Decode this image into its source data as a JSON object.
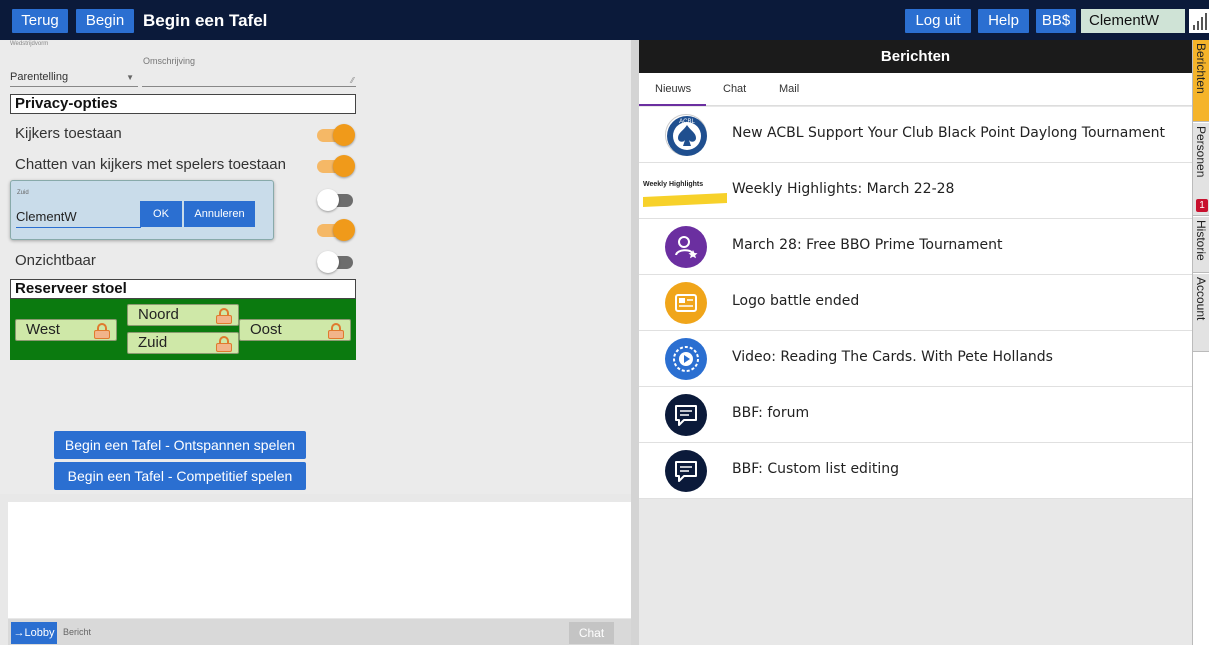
{
  "topbar": {
    "back": "Terug",
    "home": "Begin",
    "title": "Begin een Tafel",
    "logout": "Log uit",
    "help": "Help",
    "bb": "BB$",
    "user": "ClementW"
  },
  "form": {
    "wedstrijdvorm_label": "Wedstrijdvorm",
    "wedstrijdvorm_value": "Parentelling",
    "omschrijving_label": "Omschrijving"
  },
  "privacy": {
    "title": "Privacy-opties",
    "options": [
      {
        "label": "Kijkers toestaan",
        "on": true
      },
      {
        "label": "Chatten van kijkers met spelers toestaan",
        "on": true
      },
      {
        "label": "",
        "on": false
      },
      {
        "label": "",
        "on": true
      },
      {
        "label": "Onzichtbaar",
        "on": false
      }
    ]
  },
  "popup": {
    "seat_label": "Zuid",
    "input_value": "ClementW",
    "ok": "OK",
    "cancel": "Annuleren"
  },
  "seats": {
    "title": "Reserveer stoel",
    "west": "West",
    "north": "Noord",
    "east": "Oost",
    "south": "Zuid"
  },
  "actions": {
    "relax": "Begin een Tafel - Ontspannen spelen",
    "competitive": "Begin een Tafel - Competitief spelen"
  },
  "chat": {
    "lobby": "→Lobby",
    "placeholder": "Bericht",
    "send": "Chat"
  },
  "messages": {
    "title": "Berichten",
    "tabs": [
      "Nieuws",
      "Chat",
      "Mail"
    ],
    "news": [
      {
        "title": "New ACBL Support Your Club Black Point Daylong Tournament",
        "icon": "acbl-logo-icon",
        "icon_text": "ACBL"
      },
      {
        "title": "Weekly Highlights: March 22-28",
        "icon": "weekly-highlights-banner",
        "icon_text": "Weekly Highlights"
      },
      {
        "title": "March 28: Free BBO Prime Tournament",
        "icon": "user-star-icon"
      },
      {
        "title": "Logo battle ended",
        "icon": "image-card-icon"
      },
      {
        "title": "Video: Reading The Cards. With Pete Hollands",
        "icon": "video-play-icon"
      },
      {
        "title": "BBF: forum",
        "icon": "chat-bubble-icon"
      },
      {
        "title": "BBF: Custom list editing",
        "icon": "chat-bubble-icon"
      }
    ]
  },
  "side_tabs": {
    "berichten": "Berichten",
    "personen": "Personen",
    "personen_badge": "1",
    "historie": "Historie",
    "account": "Account"
  },
  "colors": {
    "topbar": "#0b1a3a",
    "button": "#2b6fd1",
    "toggle_on": "#f09a1a",
    "seat_area": "#0b7a0f",
    "active_tab": "#f5b42a"
  }
}
